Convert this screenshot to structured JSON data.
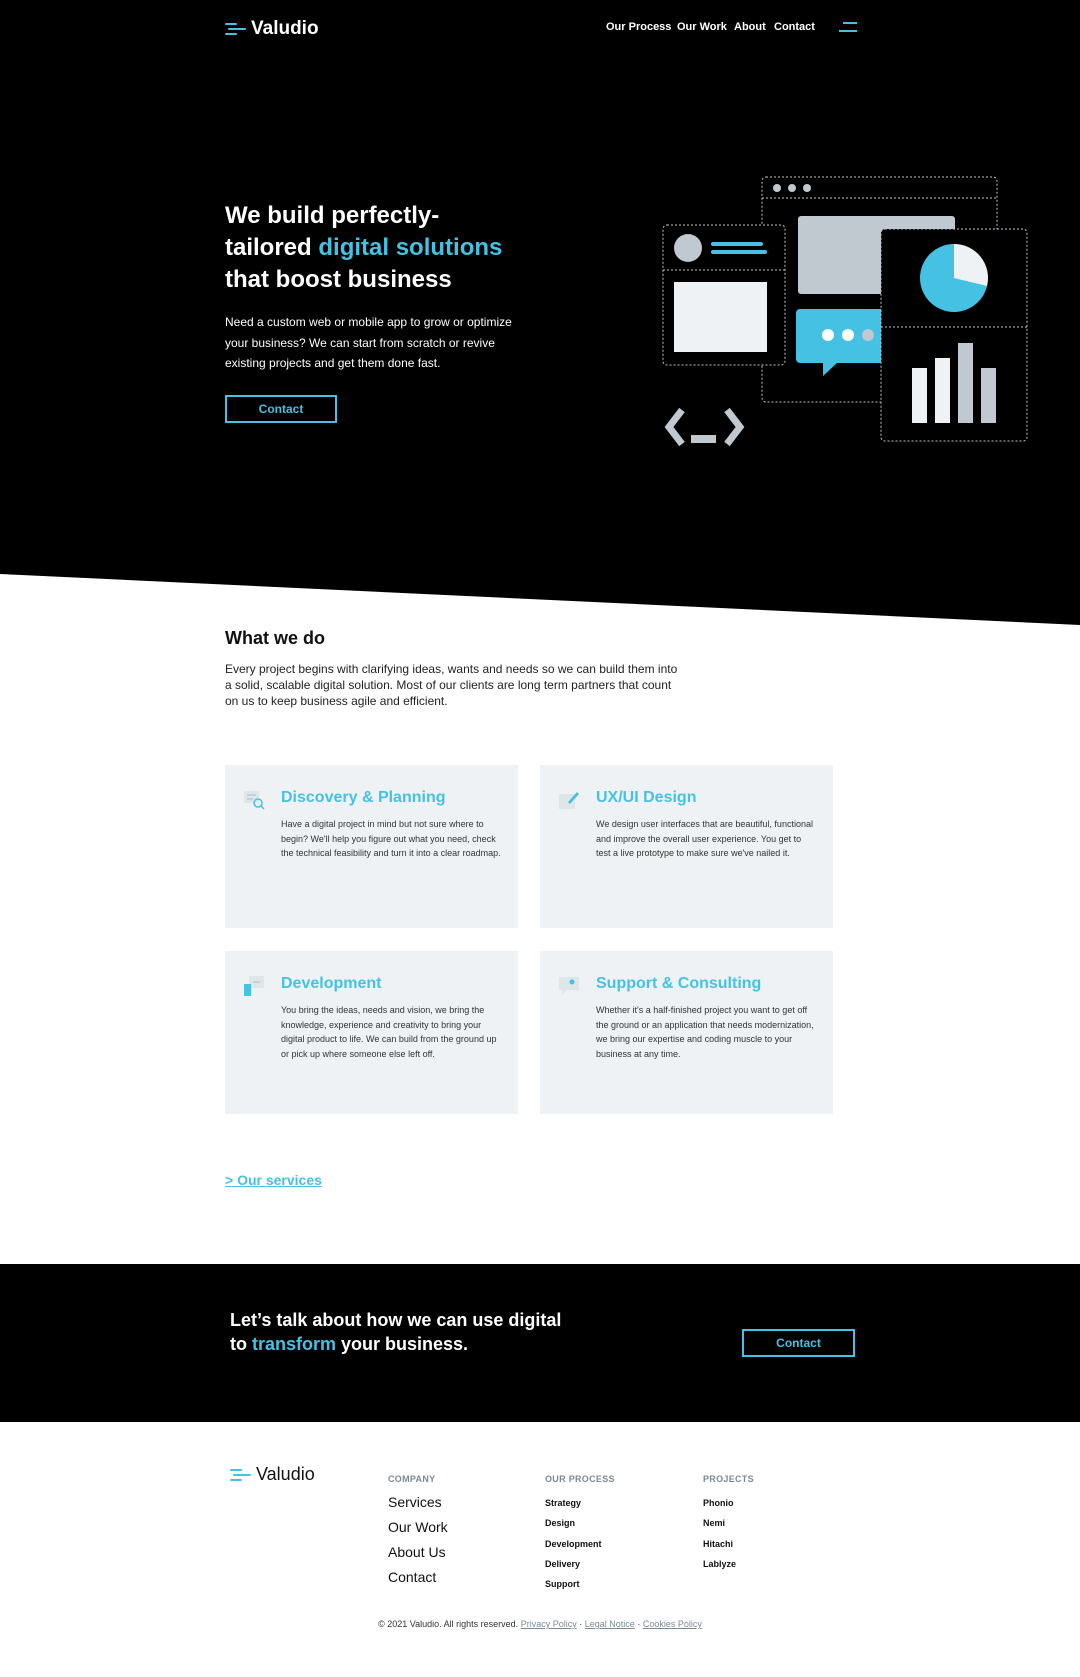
{
  "brand": {
    "name": "Valudio",
    "accent": "#45c2e3"
  },
  "nav": {
    "items": [
      "Our Process",
      "Our Work",
      "About",
      "Contact"
    ],
    "menu_icon": "hamburger-icon"
  },
  "hero": {
    "title_line1": "We build perfectly-",
    "title_line2_plain": "tailored ",
    "title_line2_accent": "digital solutions",
    "title_line3": "that boost business",
    "description": "Need a custom web or mobile app to grow or optimize your business? We can start from scratch or revive existing projects and get them done fast.",
    "cta_label": "Contact"
  },
  "what_we_do": {
    "title": "What we do",
    "description": "Every project begins with clarifying ideas, wants and needs so we can build them into a solid, scalable digital solution. Most of our clients are long term partners that count on us to keep business agile and efficient.",
    "cards": [
      {
        "icon": "discovery-icon",
        "title": "Discovery & Planning",
        "text": "Have a digital project in mind but not sure where to begin? We'll help you figure out what you need, check the technical feasibility and turn it into a clear roadmap."
      },
      {
        "icon": "design-icon",
        "title": "UX/UI Design",
        "text": "We design user interfaces that are beautiful, functional and improve the overall user experience. You get to test a live prototype to make sure we've nailed it."
      },
      {
        "icon": "development-icon",
        "title": "Development",
        "text": "You bring the ideas, needs and vision, we bring the knowledge, experience and creativity to bring your digital product to life. We can build from the ground up or pick up where someone else left off."
      },
      {
        "icon": "consulting-icon",
        "title": "Support & Consulting",
        "text": "Whether it's a half-finished project you want to get off the ground or an application that needs modernization, we bring our expertise and coding muscle to your business at any time."
      }
    ],
    "services_link": "> Our services"
  },
  "cta_band": {
    "line1": "Let’s talk about how we can use digital",
    "line2_pre": "to ",
    "line2_accent": "transform",
    "line2_post": " your business.",
    "button_label": "Contact"
  },
  "footer": {
    "company": {
      "heading": "COMPANY",
      "links": [
        "Services",
        "Our Work",
        "About Us",
        "Contact"
      ]
    },
    "process": {
      "heading": "OUR PROCESS",
      "links": [
        "Strategy",
        "Design",
        "Development",
        "Delivery",
        "Support"
      ]
    },
    "projects": {
      "heading": "PROJECTS",
      "links": [
        "Phonio",
        "Nemi",
        "Hitachi",
        "Lablyze"
      ]
    },
    "copyright": "© 2021 Valudio. All rights reserved.",
    "legal_links": [
      "Privacy Policy",
      "Legal Notice",
      "Cookies Policy"
    ],
    "separator": "·"
  }
}
